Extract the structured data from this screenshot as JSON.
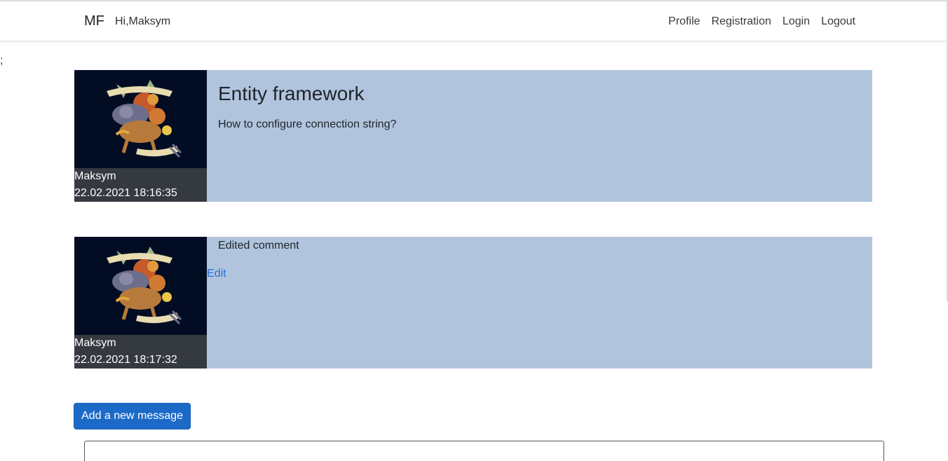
{
  "navbar": {
    "brand": "MF",
    "greeting": "Hi,Maksym",
    "links": [
      "Profile",
      "Registration",
      "Login",
      "Logout"
    ]
  },
  "stray_text": ";",
  "post": {
    "title": "Entity framework",
    "text": "How to configure connection string?",
    "author": "Maksym",
    "date": "22.02.2021 18:16:35"
  },
  "comment": {
    "text": "Edited comment",
    "edit_label": "Edit",
    "author": "Maksym",
    "date": "22.02.2021 18:17:32"
  },
  "add_message": {
    "button_label": "Add a new message",
    "input_value": ""
  },
  "colors": {
    "card_background": "#b0c4de",
    "author_panel": "#343a40",
    "avatar_background": "#020d24",
    "primary_button": "#1c6ac8",
    "link": "#2b6fd6"
  },
  "icons": {
    "avatar": "user-avatar-crest-illustration"
  }
}
